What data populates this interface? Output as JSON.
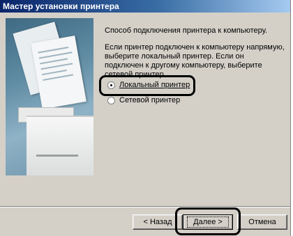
{
  "window": {
    "title": "Мастер установки принтера"
  },
  "content": {
    "intro": "Способ подключения принтера к компьютеру.",
    "description": "Если принтер подключен к компьютеру напрямую, выберите локальный принтер. Если он подключен к другому компьютеру, выберите сетевой принтер.",
    "options": [
      {
        "label": "Локальный принтер",
        "selected": true
      },
      {
        "label": "Сетевой принтер",
        "selected": false
      }
    ]
  },
  "buttons": {
    "back": "< Назад",
    "next": "Далее >",
    "cancel": "Отмена"
  }
}
